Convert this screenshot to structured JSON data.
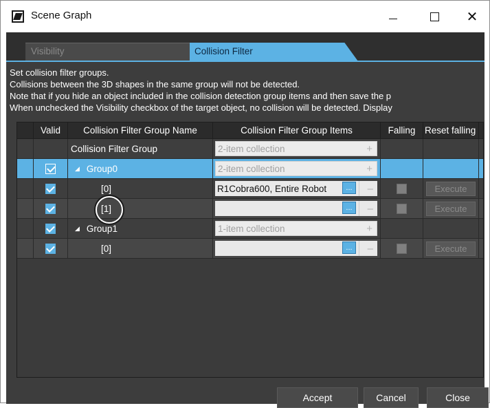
{
  "window": {
    "title": "Scene Graph",
    "minimize": "–",
    "maximize": "□",
    "close": "✕"
  },
  "tabs": [
    {
      "label": "Visibility",
      "active": false
    },
    {
      "label": "Collision Filter",
      "active": true
    }
  ],
  "description": [
    "Set collision filter groups.",
    "Collisions between the 3D shapes in the same group will not be detected.",
    "Note that if you hide an object included in the collision detection group items and then save the p",
    "When unchecked the Visibility checkbox of the target object, no collision will be detected. Display"
  ],
  "grid": {
    "headers": {
      "valid": "Valid",
      "name": "Collision Filter Group Name",
      "items": "Collision Filter Group Items",
      "falling": "Falling",
      "reset": "Reset falling"
    },
    "rows": [
      {
        "name": "Collision Filter Group",
        "items": "2-item collection",
        "items_action": "+",
        "valid": null
      },
      {
        "name": "Group0",
        "items": "2-item collection",
        "items_action": "+",
        "valid": true,
        "expand": "◢"
      },
      {
        "name": "[0]",
        "items": "R1Cobra600, Entire Robot",
        "items_action": "–",
        "valid": true,
        "ellipsis": "...",
        "execute": "Execute"
      },
      {
        "name": "[1]",
        "items": "",
        "items_action": "–",
        "valid": true,
        "ellipsis": "...",
        "execute": "Execute"
      },
      {
        "name": "Group1",
        "items": "1-item collection",
        "items_action": "+",
        "valid": true,
        "expand": "◢"
      },
      {
        "name": "[0]",
        "items": "",
        "items_action": "–",
        "valid": true,
        "ellipsis": "...",
        "execute": "Execute"
      }
    ]
  },
  "footer": {
    "accept": "Accept",
    "cancel": "Cancel",
    "close": "Close"
  },
  "colors": {
    "accent": "#5cb2e4",
    "panel": "#3d3d3d"
  }
}
